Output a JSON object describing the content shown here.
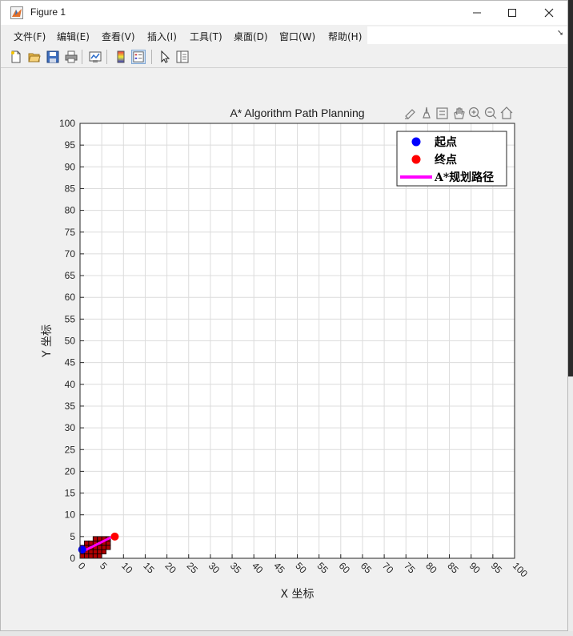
{
  "window": {
    "title": "Figure 1",
    "minimize_glyph": "—",
    "maximize_glyph": "☐",
    "close_glyph": "✕"
  },
  "menu": [
    "文件(F)",
    "编辑(E)",
    "查看(V)",
    "插入(I)",
    "工具(T)",
    "桌面(D)",
    "窗口(W)",
    "帮助(H)"
  ],
  "toolbar_icons": [
    "new-figure-icon",
    "open-file-icon",
    "save-icon",
    "print-icon",
    "link-plot-icon",
    "colorbar-icon",
    "legend-icon",
    "edit-plot-icon",
    "property-inspector-icon"
  ],
  "axes_toolbar_icons": [
    "brush-icon",
    "data-cursor-icon",
    "insert-legend-icon",
    "pan-icon",
    "zoom-in-icon",
    "zoom-out-icon",
    "home-icon"
  ],
  "colors": {
    "start": "#0000ff",
    "goal": "#ff0000",
    "path": "#ff00ff",
    "obstacle": "#b00000",
    "grid": "#dcdcdc"
  },
  "chart_data": {
    "type": "line",
    "title": "A* Algorithm Path Planning",
    "xlabel": "X 坐标",
    "ylabel": "Y 坐标",
    "xlim": [
      0,
      100
    ],
    "ylim": [
      0,
      100
    ],
    "xticks": [
      0,
      5,
      10,
      15,
      20,
      25,
      30,
      35,
      40,
      45,
      50,
      55,
      60,
      65,
      70,
      75,
      80,
      85,
      90,
      95,
      100
    ],
    "yticks": [
      0,
      5,
      10,
      15,
      20,
      25,
      30,
      35,
      40,
      45,
      50,
      55,
      60,
      65,
      70,
      75,
      80,
      85,
      90,
      95,
      100
    ],
    "grid": true,
    "legend_position": "top-right",
    "legend": [
      {
        "label": "起点",
        "kind": "marker",
        "color": "#0000ff"
      },
      {
        "label": "终点",
        "kind": "marker",
        "color": "#ff0000"
      },
      {
        "label": "A*规划路径",
        "kind": "line",
        "color": "#ff00ff"
      }
    ],
    "obstacles": [
      [
        0,
        0
      ],
      [
        1,
        0
      ],
      [
        2,
        0
      ],
      [
        3,
        0
      ],
      [
        4,
        0
      ],
      [
        0,
        1
      ],
      [
        1,
        1
      ],
      [
        2,
        1
      ],
      [
        3,
        1
      ],
      [
        4,
        1
      ],
      [
        5,
        1
      ],
      [
        0,
        2
      ],
      [
        1,
        2
      ],
      [
        2,
        2
      ],
      [
        3,
        2
      ],
      [
        4,
        2
      ],
      [
        5,
        2
      ],
      [
        6,
        2
      ],
      [
        1,
        3
      ],
      [
        2,
        3
      ],
      [
        3,
        3
      ],
      [
        4,
        3
      ],
      [
        5,
        3
      ],
      [
        6,
        3
      ],
      [
        3,
        4
      ],
      [
        4,
        4
      ],
      [
        5,
        4
      ],
      [
        6,
        4
      ]
    ],
    "start": {
      "x": 0.5,
      "y": 2
    },
    "goal": {
      "x": 8,
      "y": 5
    },
    "path": {
      "x": [
        0.5,
        1.5,
        2.5,
        3.5,
        4.5,
        5.5,
        6.5,
        7.5,
        8
      ],
      "y": [
        2,
        2,
        2.5,
        3,
        3.5,
        4,
        4.5,
        5,
        5
      ]
    }
  }
}
